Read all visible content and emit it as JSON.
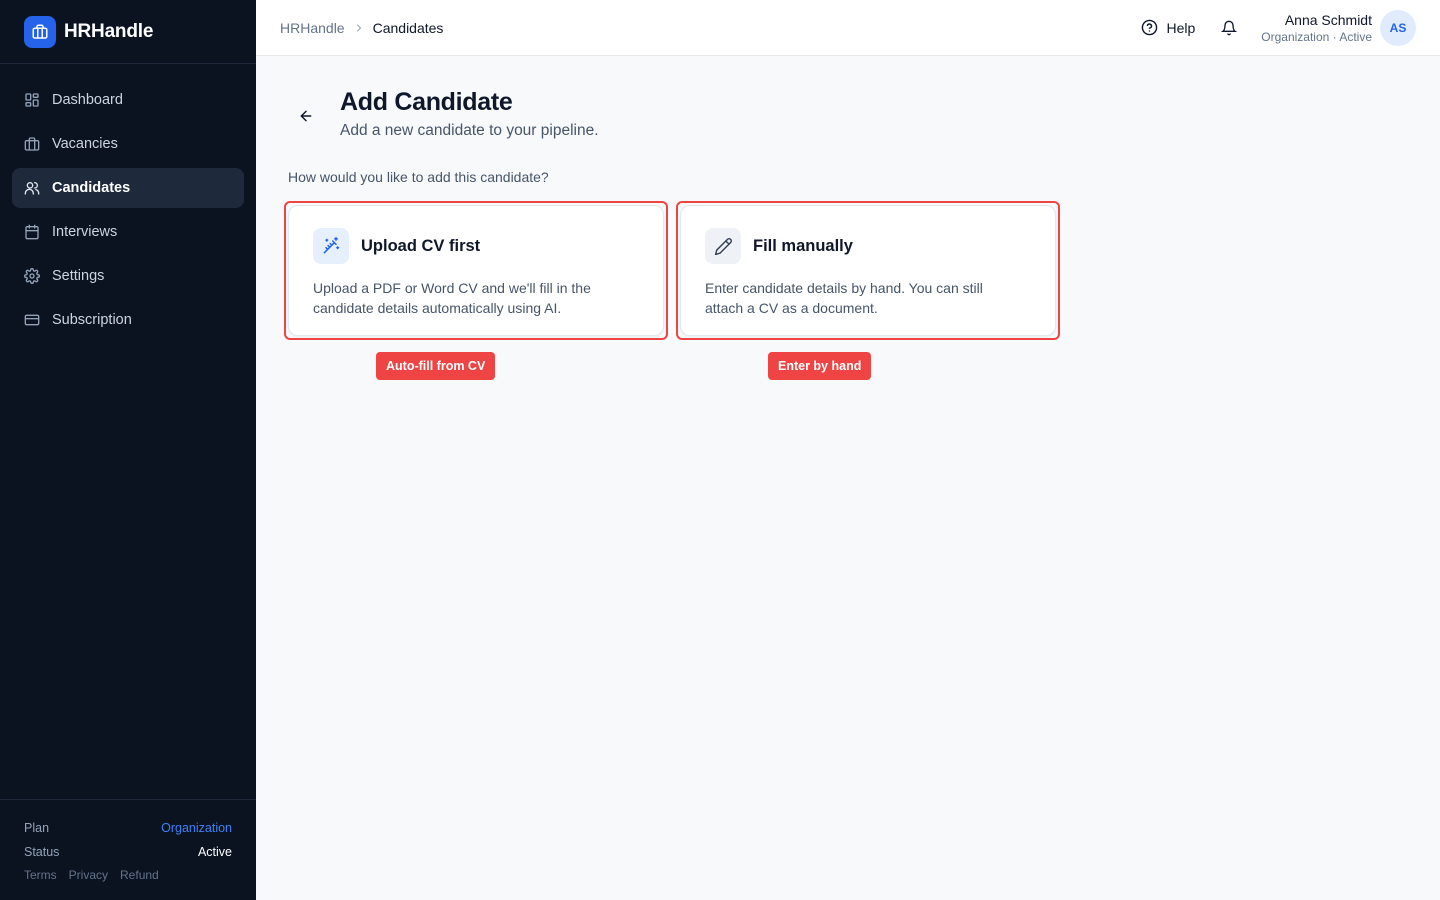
{
  "brand": {
    "name": "HRHandle",
    "accent": "#2563eb"
  },
  "sidebar": {
    "items": [
      {
        "label": "Dashboard",
        "icon": "dashboard-icon",
        "active": false
      },
      {
        "label": "Vacancies",
        "icon": "briefcase-icon",
        "active": false
      },
      {
        "label": "Candidates",
        "icon": "users-icon",
        "active": true
      },
      {
        "label": "Interviews",
        "icon": "calendar-icon",
        "active": false
      },
      {
        "label": "Settings",
        "icon": "gear-icon",
        "active": false
      },
      {
        "label": "Subscription",
        "icon": "credit-card-icon",
        "active": false
      }
    ],
    "footer": {
      "plan_label": "Plan",
      "plan_value": "Organization",
      "status_label": "Status",
      "status_value": "Active",
      "links": [
        "Terms",
        "Privacy",
        "Refund"
      ]
    }
  },
  "header": {
    "breadcrumb": {
      "root": "HRHandle",
      "current": "Candidates"
    },
    "help_label": "Help",
    "user": {
      "name": "Anna Schmidt",
      "subtitle": "Organization · Active",
      "initials": "AS"
    }
  },
  "main": {
    "title": "Add Candidate",
    "subtitle": "Add a new candidate to your pipeline.",
    "question": "How would you like to add this candidate?",
    "options": [
      {
        "title": "Upload CV first",
        "description": "Upload a PDF or Word CV and we'll fill in the candidate details automatically using AI.",
        "icon": "magic-wand-icon",
        "tag": "Auto-fill from CV"
      },
      {
        "title": "Fill manually",
        "description": "Enter candidate details by hand. You can still attach a CV as a document.",
        "icon": "pencil-icon",
        "tag": "Enter by hand"
      }
    ]
  },
  "colors": {
    "sidebar_bg": "#0b1220",
    "highlight": "#ef4444",
    "page_bg": "#f8f9fb"
  }
}
